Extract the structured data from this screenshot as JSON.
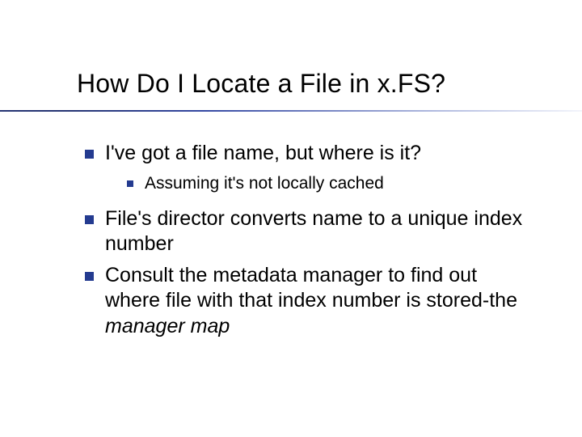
{
  "title": "How Do I Locate a File in x.FS?",
  "bullets": {
    "b1": "I've got a file name, but where is it?",
    "b1a": "Assuming it's not locally cached",
    "b2": "File's director converts name to a unique index number",
    "b3_pre": "Consult the metadata manager to find out where file with that index number is stored-the ",
    "b3_em": "manager map"
  }
}
